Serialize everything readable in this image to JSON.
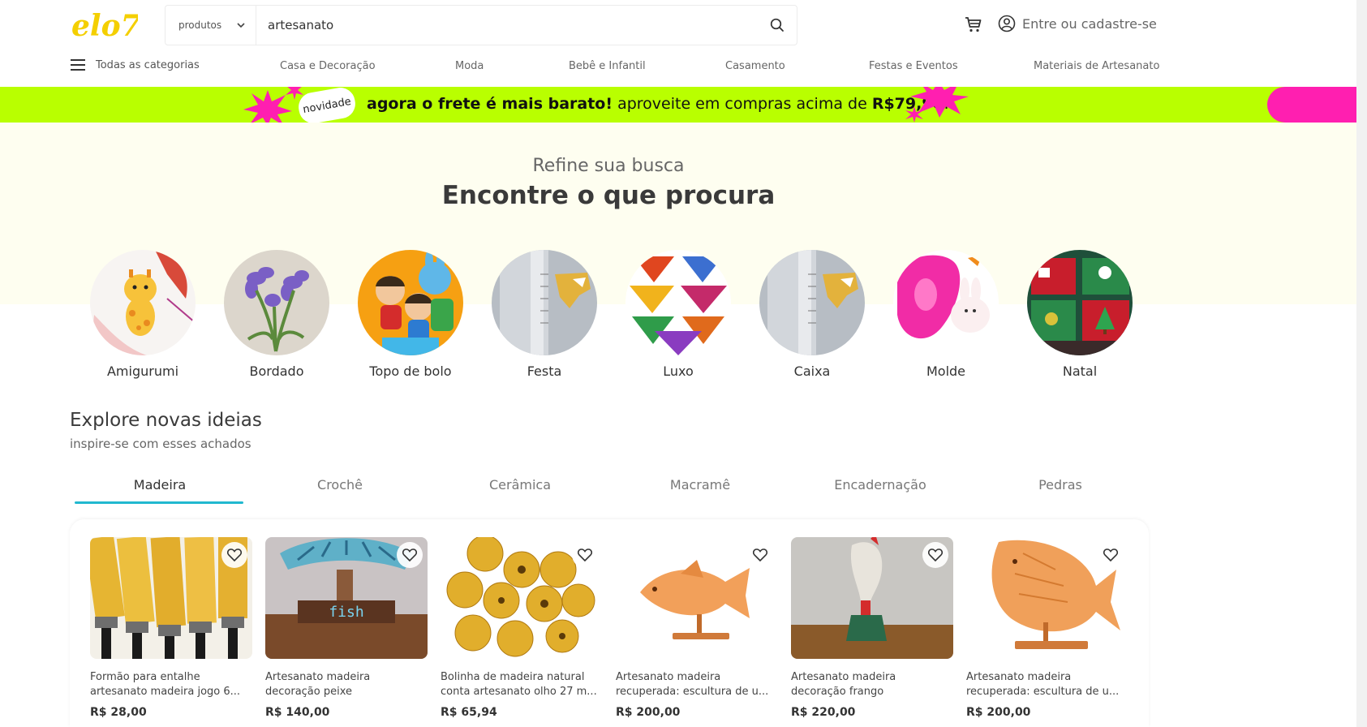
{
  "colors": {
    "accent": "#21b8cf",
    "logo": "#f4cf00",
    "promo_green": "#b9ff00",
    "promo_pink": "#ff1fb0",
    "refine_bg": "#fefef0"
  },
  "header": {
    "logo_text": "elo7",
    "search": {
      "category": "produtos",
      "value": "artesanato",
      "icon": "search-icon"
    },
    "cart_icon": "cart-icon",
    "account_icon": "user-circle-icon",
    "account_label": "Entre ou cadastre-se"
  },
  "nav": {
    "menu_label": "Todas as categorias",
    "items": [
      "Casa e Decoração",
      "Moda",
      "Bebê e Infantil",
      "Casamento",
      "Festas e Eventos",
      "Materiais de Artesanato"
    ]
  },
  "promo": {
    "badge": "novidade",
    "bold_1": "agora o frete é mais barato!",
    "text_1": " aproveite em compras acima de ",
    "bold_2": "R$79,90",
    "text_2": "!"
  },
  "refine": {
    "subtitle": "Refine sua busca",
    "title": "Encontre o que procura",
    "categories": [
      "Amigurumi",
      "Bordado",
      "Topo de bolo",
      "Festa",
      "Luxo",
      "Caixa",
      "Molde",
      "Natal"
    ]
  },
  "explore": {
    "title": "Explore novas ideias",
    "subtitle": "inspire-se com esses achados",
    "tabs": [
      "Madeira",
      "Crochê",
      "Cerâmica",
      "Macramê",
      "Encadernação",
      "Pedras"
    ],
    "active_tab": "Madeira",
    "products": [
      {
        "title": "Formão para entalhe artesanato madeira jogo 6...",
        "price": "R$ 28,00"
      },
      {
        "title": "Artesanato madeira decoração peixe",
        "price": "R$ 140,00"
      },
      {
        "title": "Bolinha de madeira natural conta artesanato olho 27 m...",
        "price": "R$ 65,94"
      },
      {
        "title": "Artesanato madeira recuperada: escultura de u...",
        "price": "R$ 200,00"
      },
      {
        "title": "Artesanato madeira decoração frango",
        "price": "R$ 220,00"
      },
      {
        "title": "Artesanato madeira recuperada: escultura de u...",
        "price": "R$ 200,00"
      }
    ]
  }
}
